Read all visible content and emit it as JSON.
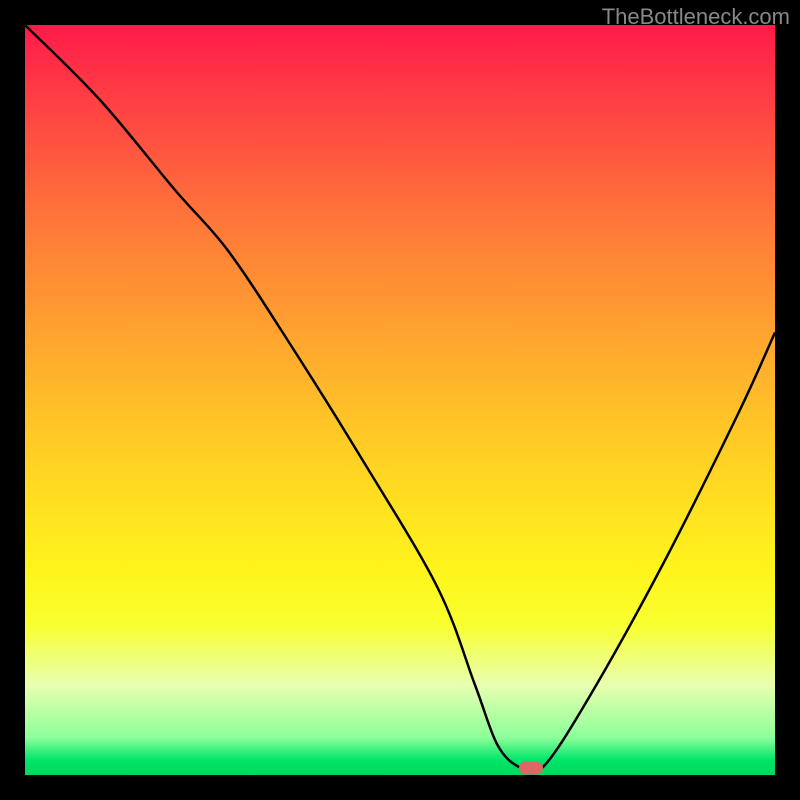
{
  "watermark": "TheBottleneck.com",
  "chart_data": {
    "type": "line",
    "title": "",
    "xlabel": "",
    "ylabel": "",
    "xlim": [
      0,
      100
    ],
    "ylim": [
      0,
      100
    ],
    "series": [
      {
        "name": "bottleneck-curve",
        "x": [
          0,
          10,
          20,
          27,
          35,
          45,
          55,
          60,
          63,
          66,
          69,
          75,
          85,
          95,
          100
        ],
        "y": [
          100,
          90,
          78,
          70,
          58,
          42,
          25,
          12,
          4,
          1,
          1,
          10,
          28,
          48,
          59
        ]
      }
    ],
    "marker": {
      "x": 67.5,
      "y": 1
    },
    "gradient": {
      "top": "#ff1a4a",
      "mid": "#ffe020",
      "bottom": "#00d85a"
    }
  }
}
